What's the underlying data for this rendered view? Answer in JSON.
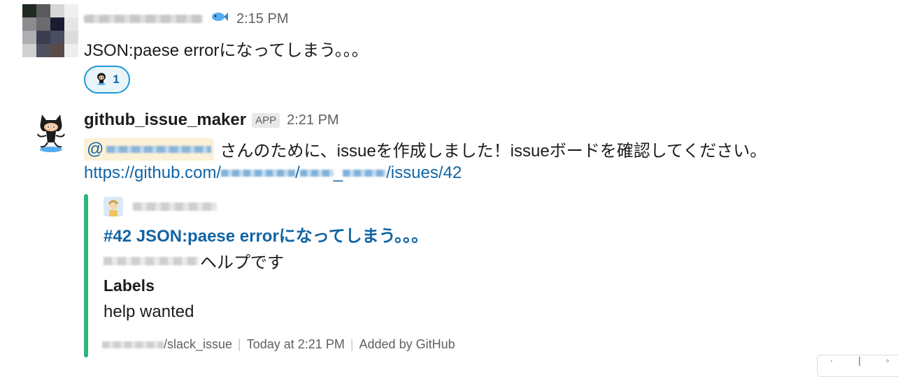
{
  "message1": {
    "time": "2:15 PM",
    "status_icon": "fish-icon",
    "text": "JSON:paese errorになってしまう。。。",
    "reaction": {
      "icon": "octocat-icon",
      "count": "1"
    }
  },
  "message2": {
    "bot_name": "github_issue_maker",
    "badge": "APP",
    "time": "2:21 PM",
    "mention_prefix": "@",
    "text": "さんのために、issueを作成しました！issueボードを確認してください。",
    "link_prefix": "https://github.com/",
    "link_sep1": "/",
    "link_mid": "_",
    "link_suffix": "/issues/42",
    "attachment": {
      "title": "#42 JSON:paese errorになってしまう。。。",
      "body_suffix": "ヘルプです",
      "field_title": "Labels",
      "field_value": "help wanted",
      "footer_repo_suffix": "/slack_issue",
      "footer_time": "Today at 2:21 PM",
      "footer_source": "Added by GitHub",
      "accent_color": "#2eb67d"
    }
  },
  "colors": {
    "link": "#1264a3",
    "text": "#1d1c1d",
    "muted": "#616061",
    "mention_bg": "#fcf1d6"
  }
}
